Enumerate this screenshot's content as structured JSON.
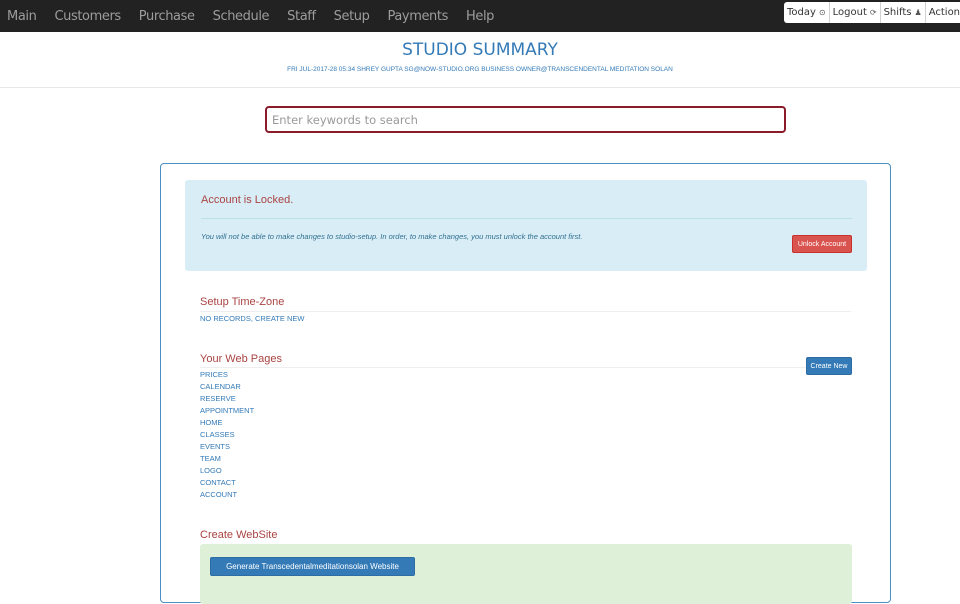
{
  "nav": {
    "items": [
      "Main",
      "Customers",
      "Purchase",
      "Schedule",
      "Staff",
      "Setup",
      "Payments",
      "Help"
    ],
    "right": [
      {
        "label": "Today",
        "icon": "clock-icon",
        "glyph": "⊙"
      },
      {
        "label": "Logout",
        "icon": "logout-icon",
        "glyph": "⟳"
      },
      {
        "label": "Shifts",
        "icon": "user-icon",
        "glyph": "♟"
      },
      {
        "label": "Actions",
        "icon": "file-icon",
        "glyph": "▯"
      }
    ]
  },
  "header": {
    "title": "STUDIO SUMMARY",
    "subtitle": "FRI JUL-2017-28 05:34 SHREY GUPTA SG@NOW-STUDIO.ORG BUSINESS OWNER@TRANSCENDENTAL MEDITATION SOLAN"
  },
  "search": {
    "placeholder": "Enter keywords to search",
    "value": ""
  },
  "alert": {
    "title": "Account is Locked.",
    "text": "You will not be able to make changes to studio-setup. In order, to make changes, you must unlock the account first.",
    "unlock_label": "Unlock Account"
  },
  "timezone": {
    "title": "Setup Time-Zone",
    "link": "NO RECORDS, CREATE NEW"
  },
  "webpages": {
    "title": "Your Web Pages",
    "create_label": "Create New",
    "pages": [
      "PRICES",
      "CALENDAR",
      "RESERVE",
      "APPOINTMENT",
      "HOME",
      "CLASSES",
      "EVENTS",
      "TEAM",
      "LOGO",
      "CONTACT",
      "ACCOUNT"
    ]
  },
  "website": {
    "title": "Create WebSite",
    "generate_label": "Generate Transcedentalmeditationsolan Website"
  },
  "colors": {
    "nav_bg": "#222222",
    "accent": "#337ab7",
    "danger": "#d9534f",
    "section_title": "#a94442",
    "alert_bg": "#d9edf7",
    "success_bg": "#dff0d8",
    "search_border": "#8b1a2b"
  }
}
